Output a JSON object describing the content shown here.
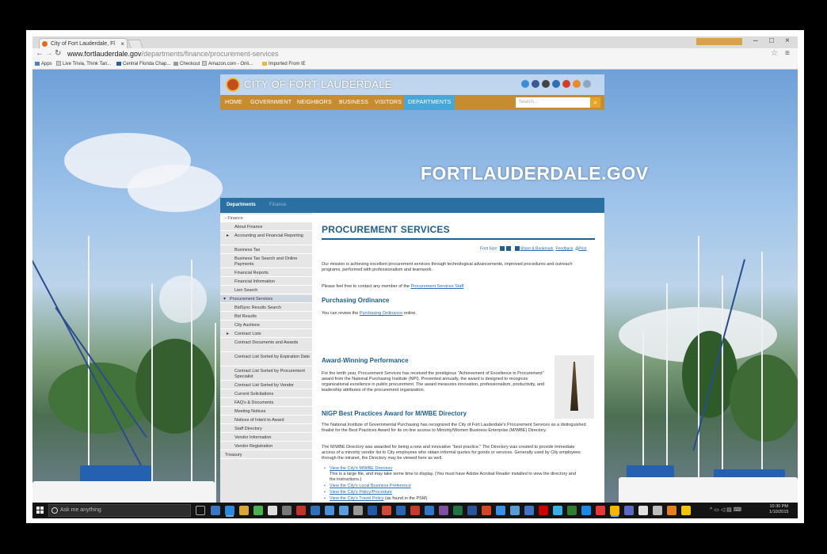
{
  "browser": {
    "tab_title": "City of Fort Lauderdale, Fl",
    "tab_close": "×",
    "user_badge": "",
    "window_controls": [
      "–",
      "□",
      "×"
    ],
    "url_host": "www.fortlauderdale.gov",
    "url_path": "/departments/finance/procurement-services",
    "bookmarks": [
      "Apps",
      "Live Trivia, Think Tan...",
      "Central Florida Chap...",
      "Checkout",
      "Amazon.com - Onli...",
      "Imported From IE"
    ]
  },
  "site": {
    "brand": "CITY OF FORT LAUDERDALE",
    "nav": [
      "HOME",
      "GOVERNMENT",
      "NEIGHBORS",
      "BUSINESS",
      "VISITORS",
      "DEPARTMENTS"
    ],
    "search_placeholder": "Search...",
    "hero_domain": "FORTLAUDERDALE.GOV",
    "breadcrumb": [
      "Departments",
      "Finance"
    ]
  },
  "sidebar": {
    "section": "Finance",
    "items": [
      "About Finance",
      "Accounting and Financial Reporting",
      "Business Tax",
      "Business Tax Search and Online Payments",
      "Financial Reports",
      "Financial Information",
      "Lien Search",
      "Procurement Services",
      "BidSync Results Search",
      "Bid Results",
      "City Auctions",
      "Contract Lists",
      "Contract Documents and Awards",
      "Contract List Sorted by Expiration Date",
      "Contract List Sorted by Procurement Specialist",
      "Contract List Sorted by Vendor",
      "Current Solicitations",
      "FAQ's & Documents",
      "Meeting Notices",
      "Notices of Intent to Award",
      "Staff Directory",
      "Vendor Information",
      "Vendor Registration",
      "Treasury"
    ]
  },
  "main": {
    "title": "PROCUREMENT SERVICES",
    "tools": [
      "Font Size:",
      "Share & Bookmark",
      "Feedback",
      "Print"
    ],
    "intro": "Our mission is achieving excellent procurement services through technological advancements, improved procedures and outreach programs, performed with professionalism and teamwork.",
    "contact_pre": "Please feel free to contact any member of the",
    "contact_link": "Procurement Services Staff",
    "h_ordinance": "Purchasing Ordinance",
    "ordinance_pre": "You can review the",
    "ordinance_link": "Purchasing Ordinance",
    "ordinance_post": "online.",
    "h_award": "Award-Winning Performance",
    "award_text": "For the tenth year, Procurement Services has received the prestigious \"Achievement of Excellence in Procurement\" award from the National Purchasing Institute (NPI). Presented annually, the award is designed to recognize organizational excellence in public procurement. The award measures innovation, professionalism, productivity, and leadership attributes of the procurement organization.",
    "h_nigp": "NIGP Best Practices Award for M/WBE Directory",
    "nigp_text": "The National Institute of Governmental Purchasing has recognized the City of Fort Lauderdale's Procurement Services as a distinguished finalist for the Best Practices Award for its on-line access to Minority/Women Business Enterprise (M/WBE) Directory.",
    "mwbe_text": "The M/WBE Directory was awarded for being a new and innovative \"best practice.\" The Directory was created to provide immediate access of a minority vendor list to City employees who obtain informal quotes for goods or services. Generally used by City employees through the intranet, the Directory may be viewed here as well.",
    "links": [
      "View the City's M/WBE Directory",
      "View the City's Local Business Preference",
      "View the City's Policy/Procedure",
      "View the City's Travel Policy"
    ],
    "link1_note": "This is a large file, and may take some time to display. (You must have Adobe Acrobat Reader installed to view the directory and the instructions.)",
    "link4_note": "(as found in the PSM)"
  },
  "taskbar": {
    "search": "Ask me anything",
    "time": "10:30 PM",
    "date": "1/10/2015"
  }
}
